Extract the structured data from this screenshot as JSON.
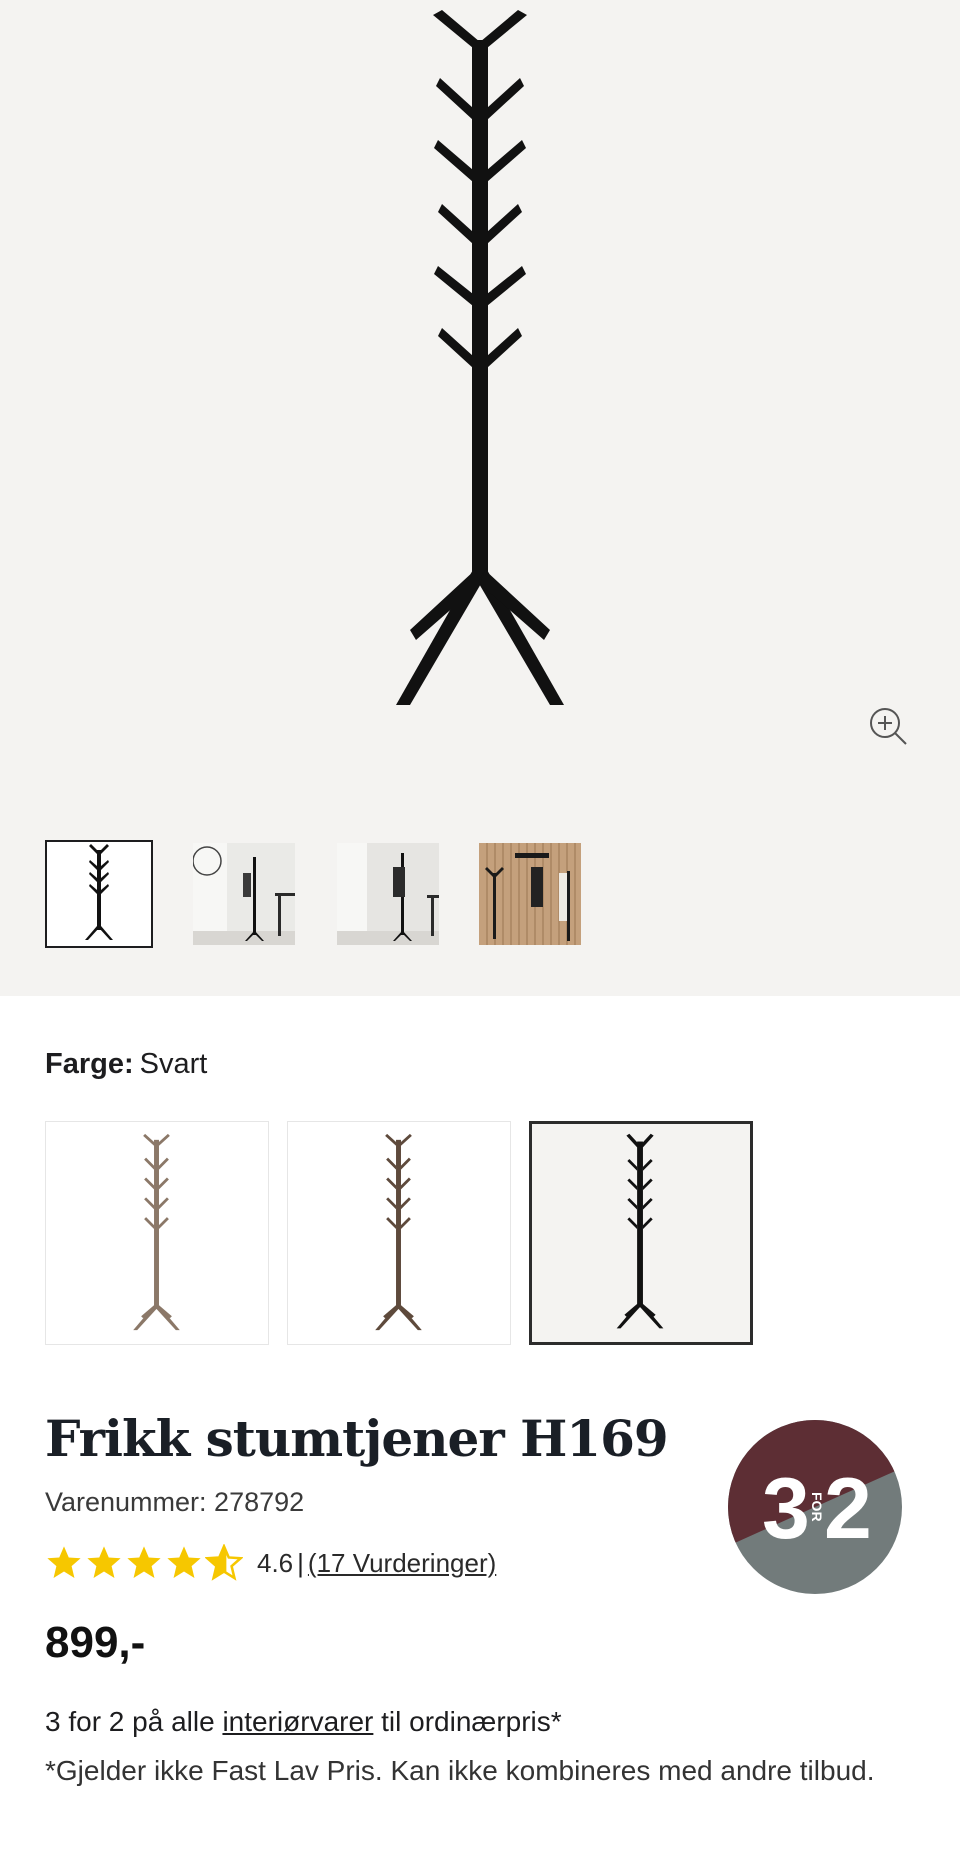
{
  "gallery": {
    "zoom_icon": "zoom-in-icon",
    "thumbnails": [
      {
        "name": "thumbnail-1",
        "selected": true
      },
      {
        "name": "thumbnail-2",
        "selected": false
      },
      {
        "name": "thumbnail-3",
        "selected": false
      },
      {
        "name": "thumbnail-4",
        "selected": false
      }
    ]
  },
  "color": {
    "label": "Farge:",
    "value": "Svart",
    "options": [
      {
        "color": "#8b7868",
        "selected": false
      },
      {
        "color": "#5e4a3c",
        "selected": false
      },
      {
        "color": "#111111",
        "selected": true
      }
    ]
  },
  "product": {
    "title": "Frikk stumtjener H169",
    "sku_label": "Varenummer: 278792",
    "rating_value": "4.6",
    "rating_separator": "|",
    "rating_link": "(17 Vurderinger)",
    "rating_stars": 4.6,
    "price": "899,-"
  },
  "badge": {
    "left": "3",
    "middle": "FOR",
    "right": "2",
    "top_color": "#5d2e34",
    "bottom_color": "#727b7b"
  },
  "promo": {
    "prefix": "3 for 2 på alle ",
    "link": "interiørvarer",
    "suffix": " til ordinærpris*",
    "disclaimer": "*Gjelder ikke Fast Lav Pris. Kan ikke kombineres med andre tilbud."
  }
}
